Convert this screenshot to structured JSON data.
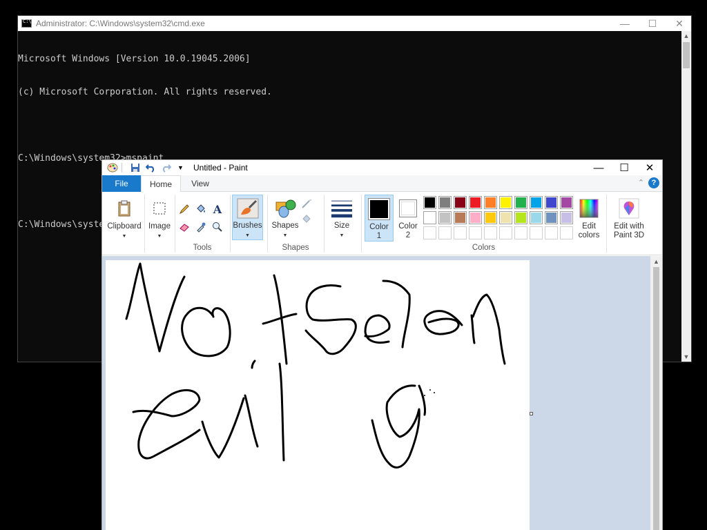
{
  "cmd": {
    "title": "Administrator: C:\\Windows\\system32\\cmd.exe",
    "lines": [
      "Microsoft Windows [Version 10.0.19045.2006]",
      "(c) Microsoft Corporation. All rights reserved.",
      "",
      "C:\\Windows\\system32>mspaint",
      "",
      "C:\\Windows\\system32>"
    ]
  },
  "paint": {
    "title": "Untitled - Paint",
    "tabs": {
      "file": "File",
      "home": "Home",
      "view": "View"
    },
    "ribbon": {
      "clipboard": "Clipboard",
      "image": "Image",
      "tools_label": "Tools",
      "brushes": "Brushes",
      "shapes": "Shapes",
      "shapes_group_label": "Shapes",
      "size": "Size",
      "color1_line1": "Color",
      "color1_line2": "1",
      "color2_line1": "Color",
      "color2_line2": "2",
      "colors_label": "Colors",
      "edit_colors_line1": "Edit",
      "edit_colors_line2": "colors",
      "paint3d_line1": "Edit with",
      "paint3d_line2": "Paint 3D"
    },
    "colors": {
      "color1": "#000000",
      "color2": "#ffffff",
      "palette_row1": [
        "#000000",
        "#7f7f7f",
        "#880015",
        "#ed1c24",
        "#ff7f27",
        "#fff200",
        "#22b14c",
        "#00a2e8",
        "#3f48cc",
        "#a349a4"
      ],
      "palette_row2": [
        "#ffffff",
        "#c3c3c3",
        "#b97a57",
        "#ffaec9",
        "#ffc90e",
        "#efe4b0",
        "#b5e61d",
        "#99d9ea",
        "#7092be",
        "#c8bfe7"
      ],
      "palette_row3": [
        "#ffffff",
        "#ffffff",
        "#ffffff",
        "#ffffff",
        "#ffffff",
        "#ffffff",
        "#ffffff",
        "#ffffff",
        "#ffffff",
        "#ffffff"
      ]
    }
  }
}
